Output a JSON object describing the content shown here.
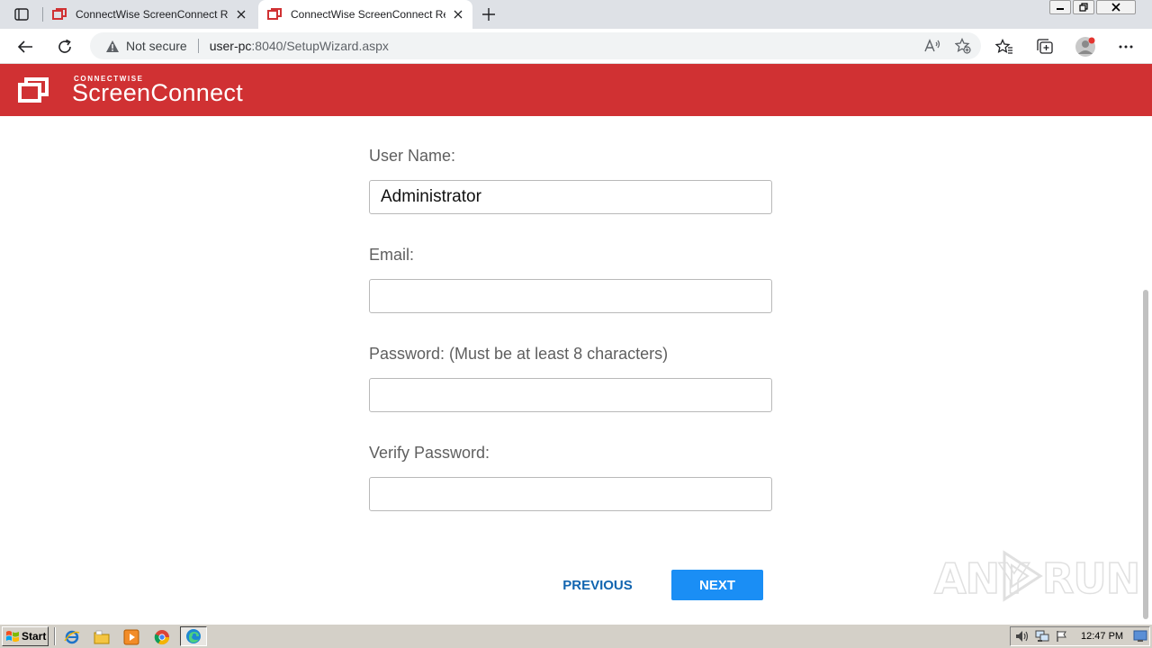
{
  "browser": {
    "tabs": [
      {
        "title": "ConnectWise ScreenConnect Rer",
        "active": false
      },
      {
        "title": "ConnectWise ScreenConnect Rer",
        "active": true
      }
    ],
    "address": {
      "security_label": "Not secure",
      "host": "user-pc",
      "path": ":8040/SetupWizard.aspx"
    }
  },
  "header": {
    "brand_top": "CONNECTWISE",
    "brand": "ScreenConnect",
    "color": "#d03133"
  },
  "form": {
    "username": {
      "label": "User Name:",
      "value": "Administrator"
    },
    "email": {
      "label": "Email:",
      "value": ""
    },
    "password": {
      "label": "Password: (Must be at least 8 characters)",
      "value": ""
    },
    "verify_password": {
      "label": "Verify Password:",
      "value": ""
    }
  },
  "buttons": {
    "previous": "PREVIOUS",
    "next": "NEXT",
    "next_color": "#1a8ef5"
  },
  "watermark": {
    "left": "ANY",
    "right": "RUN"
  },
  "taskbar": {
    "start_label": "Start",
    "clock": "12:47 PM"
  }
}
